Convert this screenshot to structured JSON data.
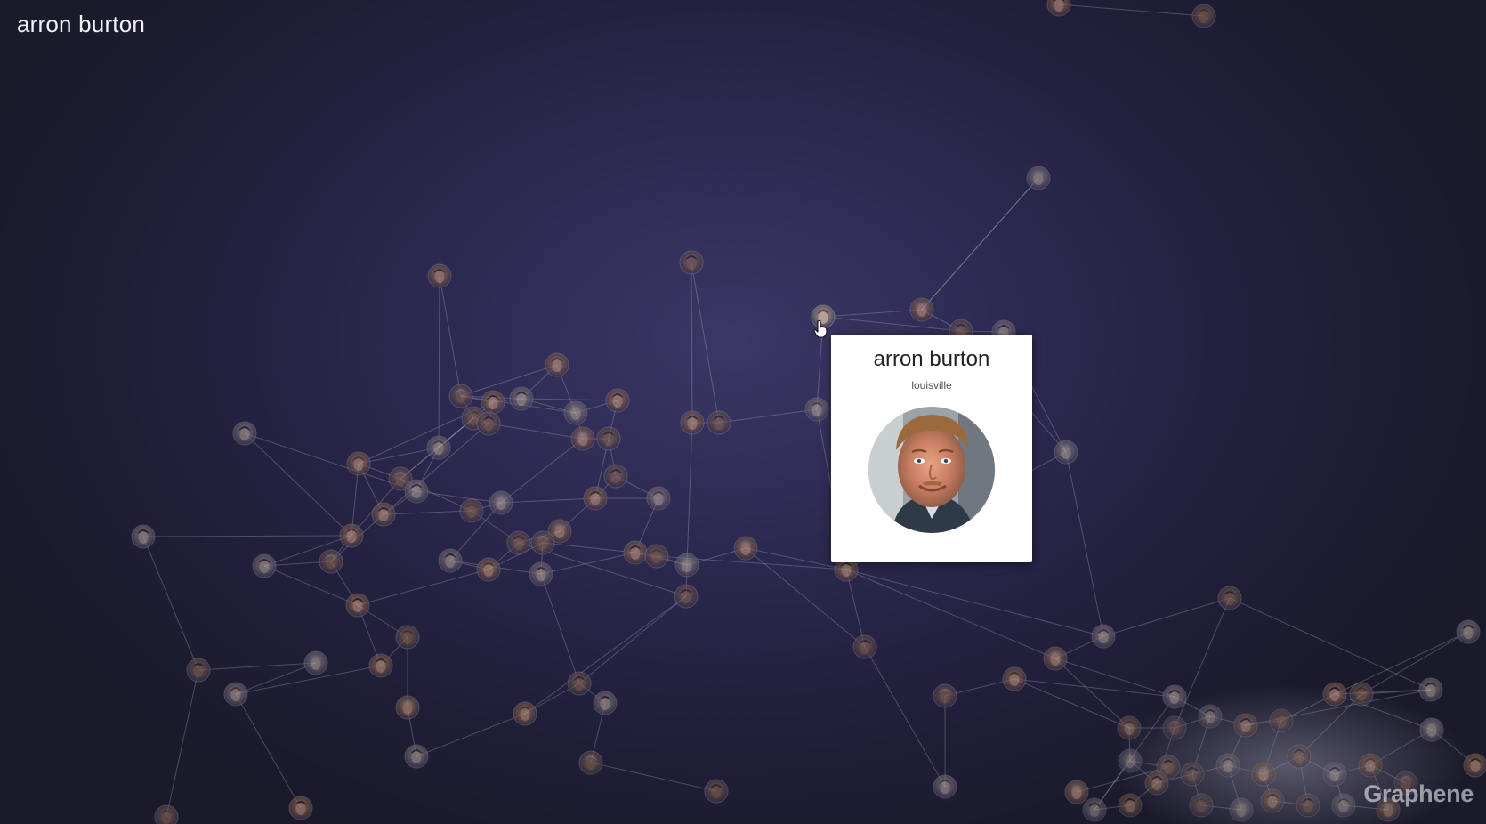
{
  "window": {
    "title": "arron burton"
  },
  "selected_node": {
    "name": "arron burton",
    "city": "louisville"
  },
  "brand": {
    "watermark": "Graphene"
  },
  "colors": {
    "background_center": "#3b3766",
    "background_edge": "#1a1a2b",
    "edge_color": "#c8c8dc",
    "card_background": "#ffffff"
  },
  "icons": {
    "cursor": "hand-pointer-icon",
    "nodes": "person-avatar-icon"
  }
}
